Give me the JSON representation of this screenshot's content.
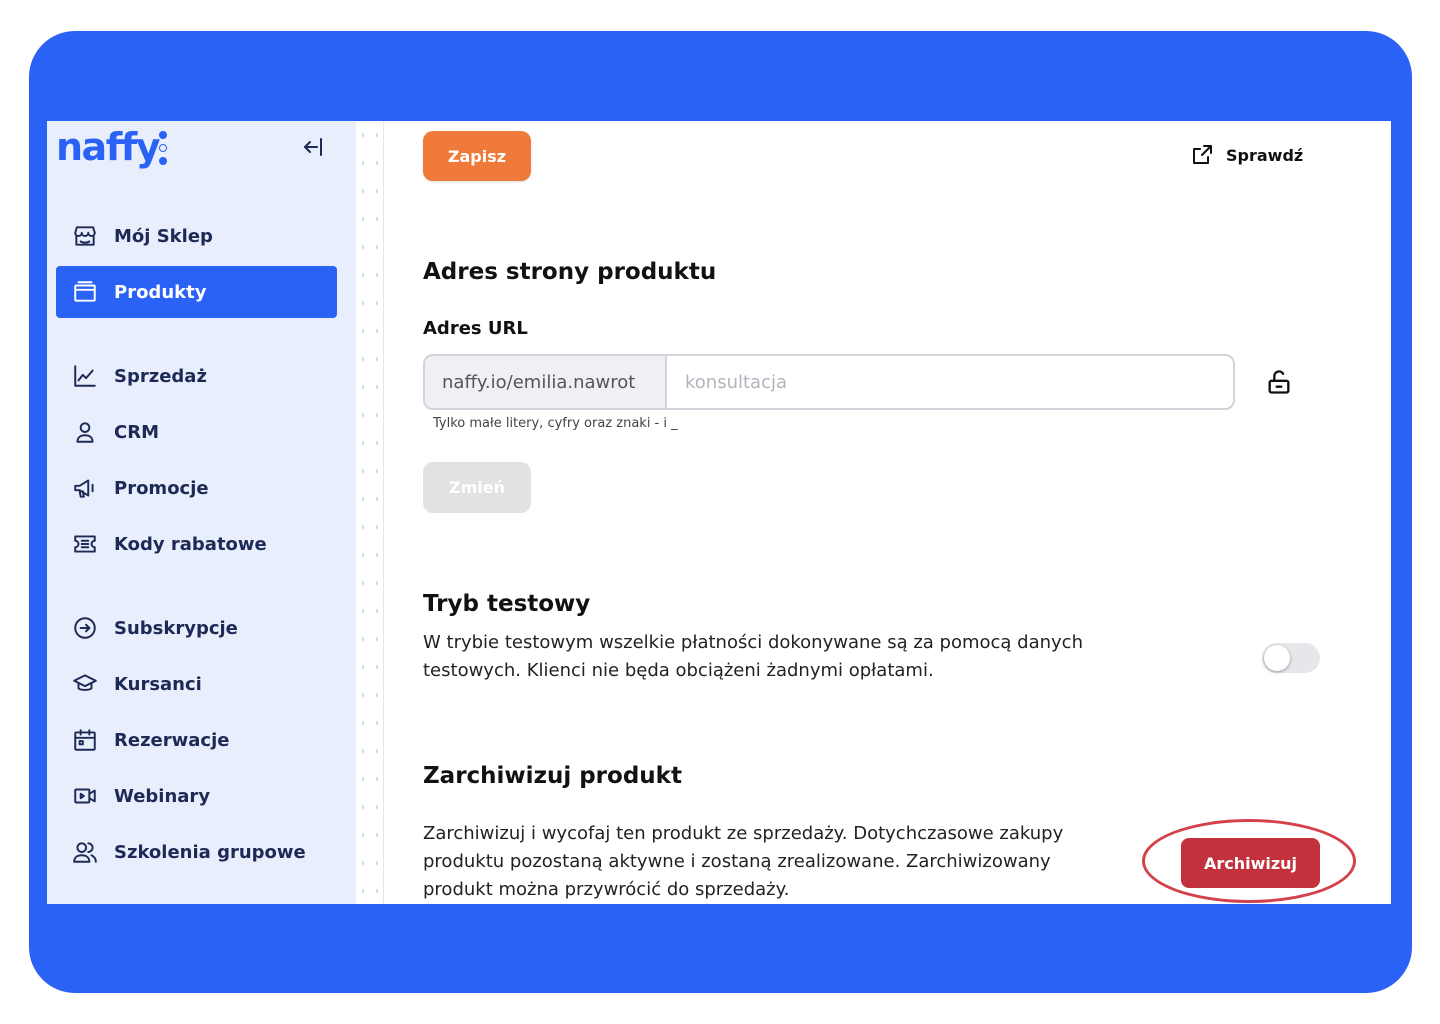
{
  "brand": {
    "logo_text": "naffy",
    "accent": "#2a62f5"
  },
  "sidebar": {
    "collapse_icon": "collapse-left-icon",
    "items": [
      {
        "label": "Mój Sklep",
        "icon": "store-icon",
        "active": false
      },
      {
        "label": "Produkty",
        "icon": "folder-icon",
        "active": true
      },
      {
        "label": "Sprzedaż",
        "icon": "chart-line-icon",
        "active": false
      },
      {
        "label": "CRM",
        "icon": "user-icon",
        "active": false
      },
      {
        "label": "Promocje",
        "icon": "megaphone-icon",
        "active": false
      },
      {
        "label": "Kody rabatowe",
        "icon": "ticket-icon",
        "active": false
      },
      {
        "label": "Subskrypcje",
        "icon": "subscription-icon",
        "active": false
      },
      {
        "label": "Kursanci",
        "icon": "graduation-cap-icon",
        "active": false
      },
      {
        "label": "Rezerwacje",
        "icon": "calendar-icon",
        "active": false
      },
      {
        "label": "Webinary",
        "icon": "video-icon",
        "active": false
      },
      {
        "label": "Szkolenia grupowe",
        "icon": "users-icon",
        "active": false
      }
    ]
  },
  "toolbar": {
    "save_label": "Zapisz",
    "check_label": "Sprawdź"
  },
  "address_section": {
    "title": "Adres strony produktu",
    "url_label": "Adres URL",
    "url_prefix": "naffy.io/emilia.nawrot",
    "url_value": "",
    "url_placeholder": "konsultacja",
    "hint": "Tylko małe litery, cyfry oraz znaki - i _",
    "change_label": "Zmień"
  },
  "test_mode": {
    "title": "Tryb testowy",
    "description": "W trybie testowym wszelkie płatności dokonywane są za pomocą danych testowych. Klienci nie będa obciążeni żadnymi opłatami.",
    "enabled": false
  },
  "archive": {
    "title": "Zarchiwizuj produkt",
    "description": "Zarchiwizuj i wycofaj ten produkt ze sprzedaży. Dotychczasowe zakupy produktu pozostaną aktywne i zostaną zrealizowane. Zarchiwizowany produkt można przywrócić do sprzedaży.",
    "button_label": "Archiwizuj",
    "button_color": "#c2313c"
  },
  "colors": {
    "save_button": "#f07a3a",
    "frame": "#2a62f5",
    "highlight": "#d3414a"
  }
}
